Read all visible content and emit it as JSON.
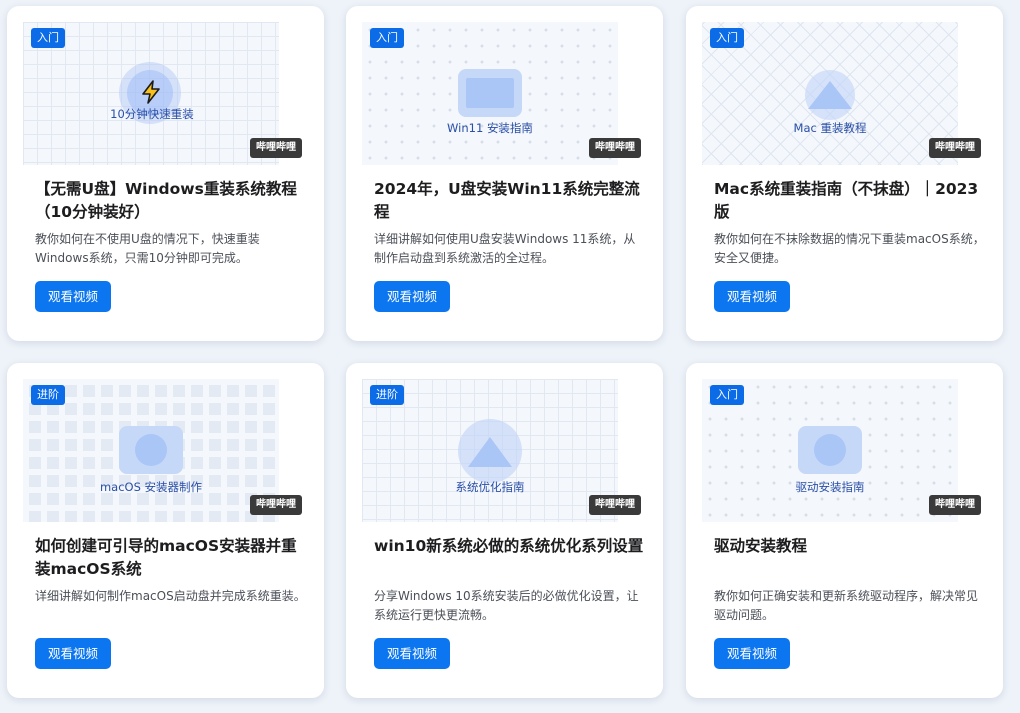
{
  "cards": [
    {
      "level": "入门",
      "source": "哔哩哔哩",
      "thumb_label": "10分钟快速重装",
      "title": "【无需U盘】Windows重装系统教程（10分钟装好）",
      "desc": "教你如何在不使用U盘的情况下，快速重装Windows系统，只需10分钟即可完成。",
      "button": "观看视频",
      "icon": "lightning-icon"
    },
    {
      "level": "入门",
      "source": "哔哩哔哩",
      "thumb_label": "Win11 安装指南",
      "title": "2024年，U盘安装Win11系统完整流程",
      "desc": "详细讲解如何使用U盘安装Windows 11系统，从制作启动盘到系统激活的全过程。",
      "button": "观看视频",
      "icon": "square-icon"
    },
    {
      "level": "入门",
      "source": "哔哩哔哩",
      "thumb_label": "Mac 重装教程",
      "title": "Mac系统重装指南（不抹盘）｜2023版",
      "desc": "教你如何在不抹除数据的情况下重装macOS系统，安全又便捷。",
      "button": "观看视频",
      "icon": "triangle-icon"
    },
    {
      "level": "进阶",
      "source": "哔哩哔哩",
      "thumb_label": "macOS 安装器制作",
      "title": "如何创建可引导的macOS安装器并重装macOS系统",
      "desc": "详细讲解如何制作macOS启动盘并完成系统重装。",
      "button": "观看视频",
      "icon": "circle-icon"
    },
    {
      "level": "进阶",
      "source": "哔哩哔哩",
      "thumb_label": "系统优化指南",
      "title": "win10新系统必做的系统优化系列设置",
      "desc": "分享Windows 10系统安装后的必做优化设置，让系统运行更快更流畅。",
      "button": "观看视频",
      "icon": "triangle-icon"
    },
    {
      "level": "入门",
      "source": "哔哩哔哩",
      "thumb_label": "驱动安装指南",
      "title": "驱动安装教程",
      "desc": "教你如何正确安装和更新系统驱动程序，解决常见驱动问题。",
      "button": "观看视频",
      "icon": "circle-icon"
    }
  ],
  "colors": {
    "accent": "#0c76f0",
    "badge": "#0c6ce8",
    "source_badge": "#3a3a3a",
    "background": "#eef3f9"
  }
}
